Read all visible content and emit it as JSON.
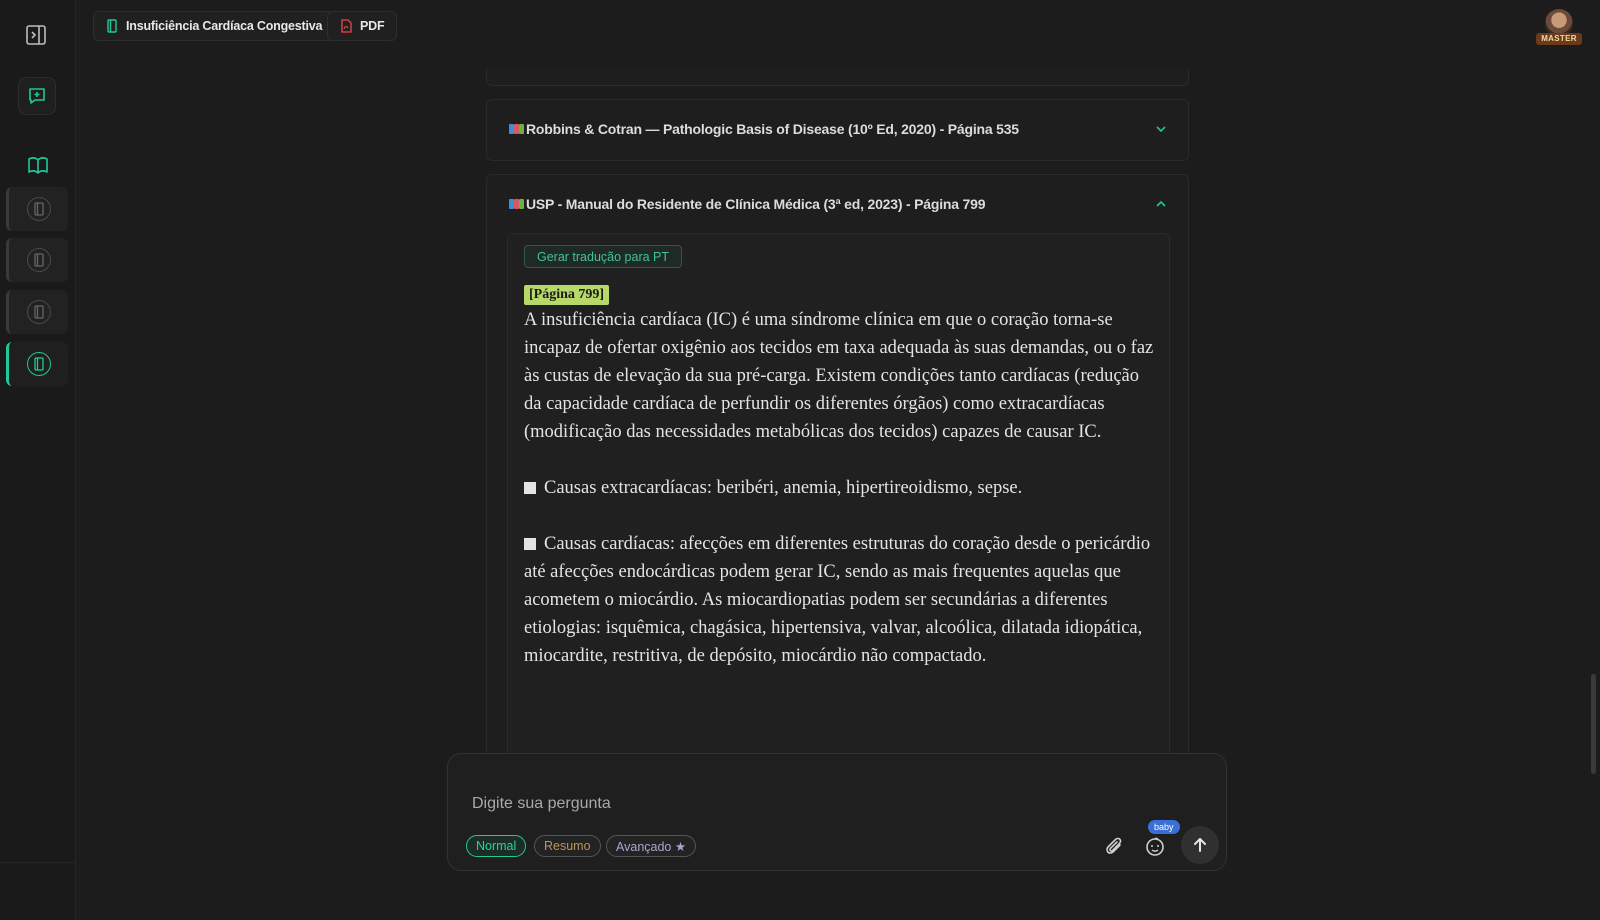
{
  "topbar": {
    "topic_tab": "Insuficiência Cardíaca Congestiva",
    "pdf_tab": "PDF",
    "avatar_badge": "MASTER"
  },
  "sidebar": {
    "doc_items": [
      {
        "active": false
      },
      {
        "active": false
      },
      {
        "active": false
      },
      {
        "active": true
      }
    ],
    "accent_color": "#20c997"
  },
  "references": [
    {
      "title": "Robbins & Cotran — Pathologic Basis of Disease (10º Ed, 2020) - Página 535",
      "expanded": false
    },
    {
      "title": "USP - Manual do Residente de Clínica Médica (3ª ed, 2023) - Página 799",
      "expanded": true
    }
  ],
  "expanded_ref": {
    "translate_button": "Gerar tradução para PT",
    "page_tag": "[Página 799]",
    "paragraph_1": "A insuficiência cardíaca (IC) é uma síndrome clínica em que o coração torna-se incapaz de ofertar oxigênio aos tecidos em taxa adequada às suas demandas, ou o faz às custas de elevação da sua pré-carga. Existem condições tanto cardíacas (redução da capacidade cardíaca de perfundir os diferentes órgãos) como extracardíacas (modificação das necessidades metabólicas dos tecidos) capazes de causar IC.",
    "paragraph_2": "Causas extracardíacas: beribéri, anemia, hipertireoidismo, sepse.",
    "paragraph_3": "Causas cardíacas: afecções em diferentes estruturas do coração desde o pericárdio até afecções endocárdicas podem gerar IC, sendo as mais frequentes aquelas que acometem o miocárdio. As miocardiopatias podem ser secundárias a diferentes etiologias: isquêmica, chagásica, hipertensiva, valvar, alcoólica, dilatada idiopática, miocardite, restritiva, de depósito, miocárdio não compactado."
  },
  "composer": {
    "placeholder": "Digite sua pergunta",
    "modes": {
      "normal": "Normal",
      "resumo": "Resumo",
      "avancado": "Avançado ★"
    },
    "selected_mode": "Normal",
    "baby_badge": "baby",
    "icons": [
      "paperclip-icon",
      "baby-face-icon",
      "arrow-up-icon"
    ]
  }
}
